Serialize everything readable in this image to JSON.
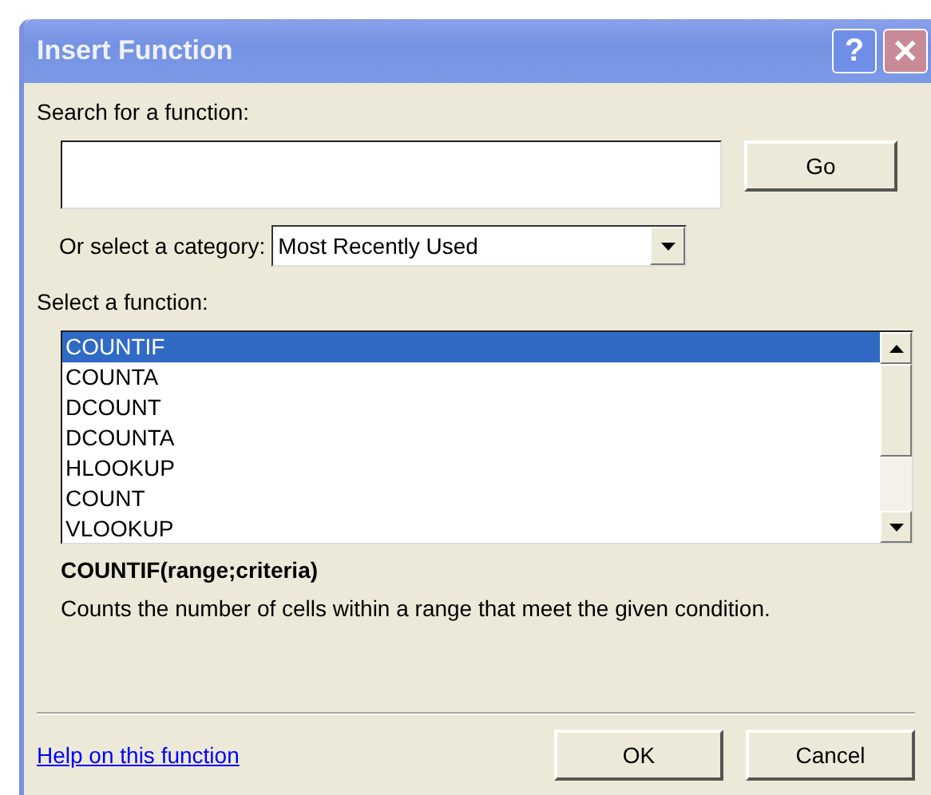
{
  "window": {
    "title": "Insert Function",
    "buttons": [
      "?",
      "✕"
    ]
  },
  "search": {
    "label": "Search for a function:",
    "button": "Go"
  },
  "category": {
    "label": "Or select a category:",
    "value": "Most Recently Used"
  },
  "functions": {
    "label": "Select a function:",
    "items": [
      {
        "name": "COUNTIF",
        "selected": true
      },
      {
        "name": "COUNTA",
        "selected": false
      },
      {
        "name": "DCOUNT",
        "selected": false
      },
      {
        "name": "DCOUNTA",
        "selected": false
      },
      {
        "name": "HLOOKUP",
        "selected": false
      },
      {
        "name": "COUNT",
        "selected": false
      },
      {
        "name": "VLOOKUP",
        "selected": false
      }
    ]
  },
  "signature": "COUNTIF(range;criteria)",
  "description": "Counts the number of cells within a range that meet the given condition.",
  "help_link": "Help on this function",
  "buttons": [
    "OK",
    "Cancel"
  ]
}
